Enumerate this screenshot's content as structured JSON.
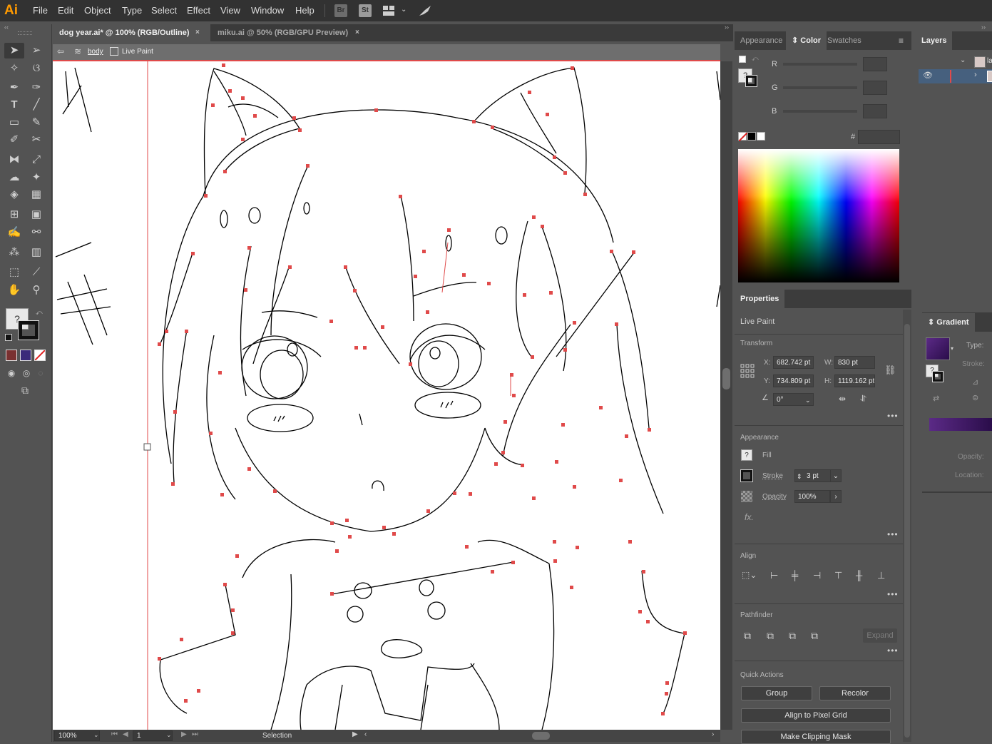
{
  "menubar": {
    "logo": "Ai",
    "items": [
      "File",
      "Edit",
      "Object",
      "Type",
      "Select",
      "Effect",
      "View",
      "Window",
      "Help"
    ],
    "bridge": "Br",
    "stock": "St"
  },
  "tabs": [
    {
      "label": "dog year.ai* @ 100% (RGB/Outline)",
      "active": true
    },
    {
      "label": "miku.ai @ 50% (RGB/GPU Preview)",
      "active": false
    }
  ],
  "tab_close": "×",
  "isolation": {
    "layer": "body",
    "group": "Live Paint"
  },
  "toolbar": {
    "fill_stroke_unknown": "?"
  },
  "status": {
    "zoom": "100%",
    "artboard": "1",
    "tool": "Selection"
  },
  "color_panel": {
    "tabs": [
      "Appearance",
      "Color",
      "Swatches"
    ],
    "active_tab": "Color",
    "channels": [
      "R",
      "G",
      "B"
    ],
    "hex_label": "#",
    "unknown": "?"
  },
  "layers_panel": {
    "tab": "Layers",
    "layer_name": "la"
  },
  "properties": {
    "tab": "Properties",
    "selection_type": "Live Paint",
    "transform": {
      "title": "Transform",
      "x_label": "X:",
      "x": "682.742 pt",
      "y_label": "Y:",
      "y": "734.809 pt",
      "w_label": "W:",
      "w": "830 pt",
      "h_label": "H:",
      "h": "1119.162 pt",
      "angle": "0°"
    },
    "appearance": {
      "title": "Appearance",
      "fill_label": "Fill",
      "fill_swatch": "?",
      "stroke_label": "Stroke",
      "stroke_value": "3 pt",
      "opacity_label": "Opacity",
      "opacity_value": "100%",
      "fx": "fx."
    },
    "align": {
      "title": "Align"
    },
    "pathfinder": {
      "title": "Pathfinder",
      "expand": "Expand"
    },
    "quick_actions": {
      "title": "Quick Actions",
      "group": "Group",
      "recolor": "Recolor",
      "align_pixel": "Align to Pixel Grid",
      "clipping_mask": "Make Clipping Mask"
    },
    "more": "•••"
  },
  "gradient_panel": {
    "tab": "Gradient",
    "type_label": "Type:",
    "stroke_label": "Stroke:",
    "opacity_label": "Opacity:",
    "location_label": "Location:",
    "unknown": "?"
  },
  "colors": {
    "accent_red": "#e04a4a",
    "gradient_start": "#5b2a86",
    "gradient_end": "#2a0d4a"
  }
}
